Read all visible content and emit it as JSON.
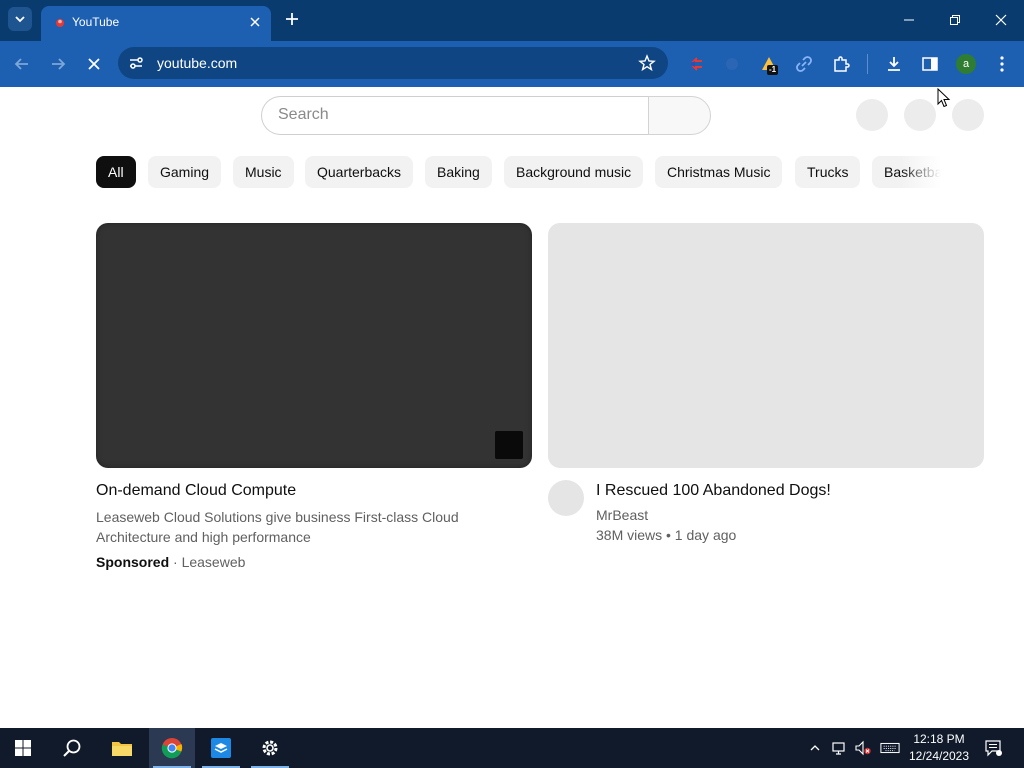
{
  "browser": {
    "tab_title": "YouTube",
    "url": "youtube.com",
    "extension_badge": "-1",
    "profile_initial": "a",
    "colors": {
      "frame": "#0a3b6e",
      "toolbar": "#1d5fb0",
      "omnibox": "#0f4583"
    }
  },
  "youtube": {
    "search_placeholder": "Search",
    "chips": [
      "All",
      "Gaming",
      "Music",
      "Quarterbacks",
      "Baking",
      "Background music",
      "Christmas Music",
      "Trucks",
      "Basketba"
    ],
    "active_chip": "All",
    "ad": {
      "title": "On-demand Cloud Compute",
      "description": "Leaseweb Cloud Solutions give business First-class Cloud Architecture and high performance",
      "sponsored_label": "Sponsored",
      "separator": "·",
      "advertiser": "Leaseweb"
    },
    "video": {
      "title": "I Rescued 100 Abandoned Dogs!",
      "channel": "MrBeast",
      "meta": "38M views • 1 day ago"
    }
  },
  "taskbar": {
    "time": "12:18 PM",
    "date": "12/24/2023",
    "apps": [
      "start-icon",
      "search-icon",
      "file-explorer-icon",
      "chrome-icon",
      "store-app-icon",
      "settings-icon"
    ]
  }
}
